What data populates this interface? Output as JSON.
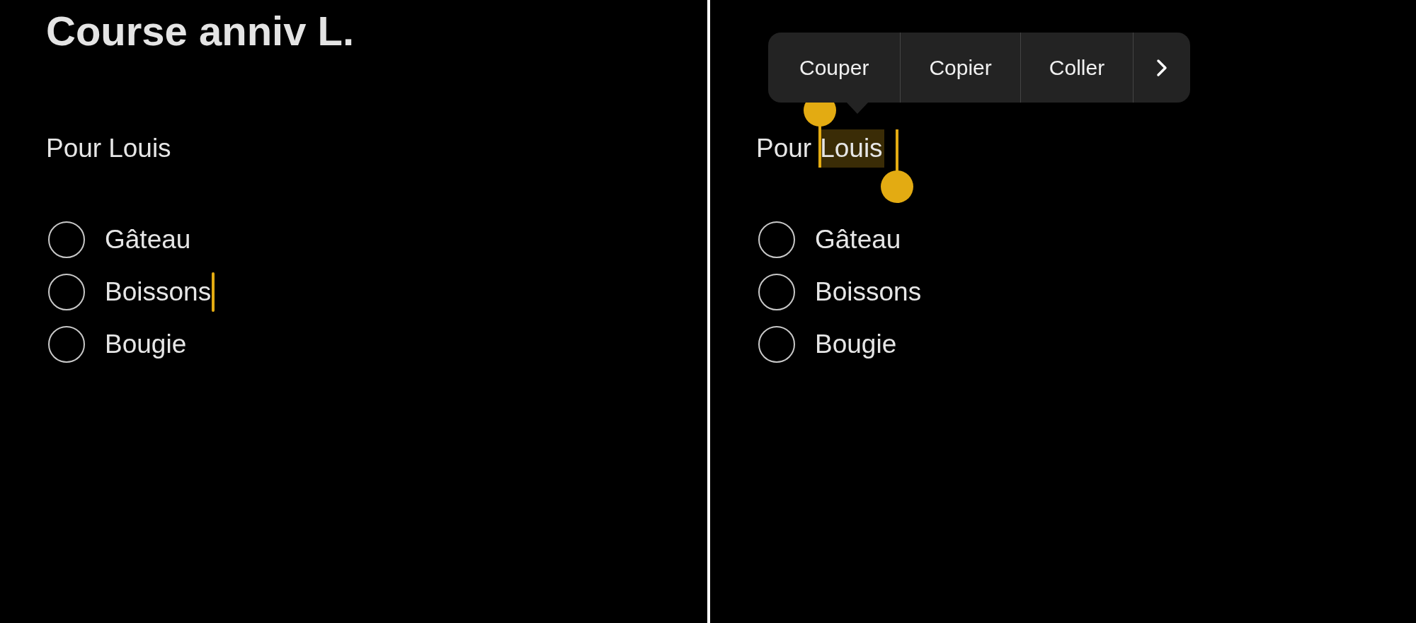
{
  "panels": [
    {
      "title": "Course anniv L.",
      "subtitle": [
        {
          "text": "Pour",
          "selected": false
        },
        {
          "text": "Louis",
          "selected": false
        }
      ],
      "checklist": [
        {
          "label": "Gâteau",
          "checked": false,
          "caret": false
        },
        {
          "label": "Boissons",
          "checked": false,
          "caret": true
        },
        {
          "label": "Bougie",
          "checked": false,
          "caret": false
        }
      ]
    },
    {
      "subtitle": [
        {
          "text": "Pour",
          "selected": false
        },
        {
          "text": "Louis",
          "selected": true
        }
      ],
      "checklist": [
        {
          "label": "Gâteau",
          "checked": false,
          "caret": false
        },
        {
          "label": "Boissons",
          "checked": false,
          "caret": false
        },
        {
          "label": "Bougie",
          "checked": false,
          "caret": false
        }
      ],
      "edit_menu": {
        "actions": [
          "Couper",
          "Copier",
          "Coller"
        ],
        "more": true
      }
    }
  ]
}
